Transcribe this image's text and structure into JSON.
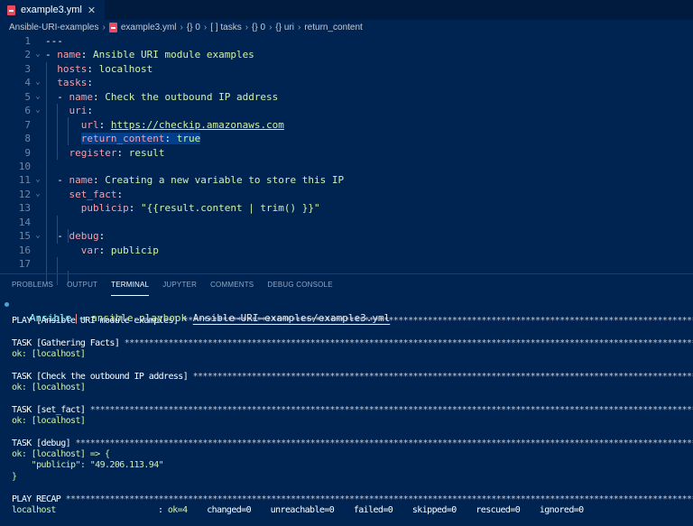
{
  "tab": {
    "title": "example3.yml",
    "icon": "yaml-file-icon"
  },
  "breadcrumb": [
    "Ansible-URI-examples",
    "example3.yml",
    "{} 0",
    "[ ] tasks",
    "{} 0",
    "{} uri",
    "return_content"
  ],
  "code": [
    {
      "n": "1",
      "parts": [
        [
          "p",
          "---"
        ]
      ]
    },
    {
      "n": "2",
      "fold": true,
      "parts": [
        [
          "p",
          "- "
        ],
        [
          "k",
          "name"
        ],
        [
          "p",
          ": "
        ],
        [
          "v",
          "Ansible URI module examples"
        ]
      ]
    },
    {
      "n": "3",
      "parts": [
        [
          "p",
          "  "
        ],
        [
          "k",
          "hosts"
        ],
        [
          "p",
          ": "
        ],
        [
          "v",
          "localhost"
        ]
      ]
    },
    {
      "n": "4",
      "fold": true,
      "parts": [
        [
          "p",
          "  "
        ],
        [
          "k",
          "tasks"
        ],
        [
          "p",
          ":"
        ]
      ]
    },
    {
      "n": "5",
      "fold": true,
      "parts": [
        [
          "p",
          "  - "
        ],
        [
          "k",
          "name"
        ],
        [
          "p",
          ": "
        ],
        [
          "v",
          "Check the outbound IP address"
        ]
      ]
    },
    {
      "n": "6",
      "fold": true,
      "parts": [
        [
          "p",
          "    "
        ],
        [
          "k",
          "uri"
        ],
        [
          "p",
          ":"
        ]
      ]
    },
    {
      "n": "7",
      "parts": [
        [
          "p",
          "      "
        ],
        [
          "k",
          "url"
        ],
        [
          "p",
          ": "
        ],
        [
          "vu",
          "https://checkip.amazonaws.com"
        ]
      ]
    },
    {
      "n": "8",
      "parts": [
        [
          "p",
          "      "
        ],
        [
          "kh",
          "return_content"
        ],
        [
          "ph",
          ": "
        ],
        [
          "vh",
          "true"
        ]
      ]
    },
    {
      "n": "9",
      "parts": [
        [
          "p",
          "    "
        ],
        [
          "k",
          "register"
        ],
        [
          "p",
          ": "
        ],
        [
          "v",
          "result"
        ]
      ]
    },
    {
      "n": "10",
      "parts": []
    },
    {
      "n": "11",
      "fold": true,
      "parts": [
        [
          "p",
          "  - "
        ],
        [
          "k",
          "name"
        ],
        [
          "p",
          ": "
        ],
        [
          "v",
          "Creating a new variable to store this IP"
        ]
      ]
    },
    {
      "n": "12",
      "fold": true,
      "parts": [
        [
          "p",
          "    "
        ],
        [
          "k",
          "set_fact"
        ],
        [
          "p",
          ":"
        ]
      ]
    },
    {
      "n": "13",
      "parts": [
        [
          "p",
          "      "
        ],
        [
          "k",
          "publicip"
        ],
        [
          "p",
          ": "
        ],
        [
          "v",
          "\"{{result.content | trim() }}\""
        ]
      ]
    },
    {
      "n": "14",
      "parts": []
    },
    {
      "n": "15",
      "fold": true,
      "parts": [
        [
          "p",
          "  - "
        ],
        [
          "k",
          "debug"
        ],
        [
          "p",
          ":"
        ]
      ]
    },
    {
      "n": "16",
      "parts": [
        [
          "p",
          "      "
        ],
        [
          "k",
          "var"
        ],
        [
          "p",
          ": "
        ],
        [
          "v",
          "publicip"
        ]
      ]
    },
    {
      "n": "17",
      "parts": []
    }
  ],
  "panel_tabs": [
    "PROBLEMS",
    "OUTPUT",
    "TERMINAL",
    "JUPYTER",
    "COMMENTS",
    "DEBUG CONSOLE"
  ],
  "active_panel_tab": "TERMINAL",
  "terminal": {
    "prompt_dir": "Ansible",
    "prompt_arrow": "→",
    "command": "ansible-playbook",
    "arg": "Ansible-URI-examples/example3.yml",
    "lines": [
      {
        "t": "PLAY [Ansible URI module examples] ",
        "stars": true
      },
      {
        "t": ""
      },
      {
        "t": "TASK [Gathering Facts] ",
        "stars": true
      },
      {
        "t": "ok: [localhost]",
        "g": true
      },
      {
        "t": ""
      },
      {
        "t": "TASK [Check the outbound IP address] ",
        "stars": true
      },
      {
        "t": "ok: [localhost]",
        "g": true
      },
      {
        "t": ""
      },
      {
        "t": "TASK [set_fact] ",
        "stars": true
      },
      {
        "t": "ok: [localhost]",
        "g": true
      },
      {
        "t": ""
      },
      {
        "t": "TASK [debug] ",
        "stars": true
      },
      {
        "t": "ok: [localhost] => {",
        "g": true
      },
      {
        "t": "    \"publicip\": \"49.206.113.94\"",
        "g": true
      },
      {
        "t": "}",
        "g": true
      },
      {
        "t": ""
      },
      {
        "t": "PLAY RECAP ",
        "stars": true
      }
    ],
    "recap": {
      "host": "localhost",
      "ok": "ok=4",
      "rest": "changed=0    unreachable=0    failed=0    skipped=0    rescued=0    ignored=0"
    }
  }
}
